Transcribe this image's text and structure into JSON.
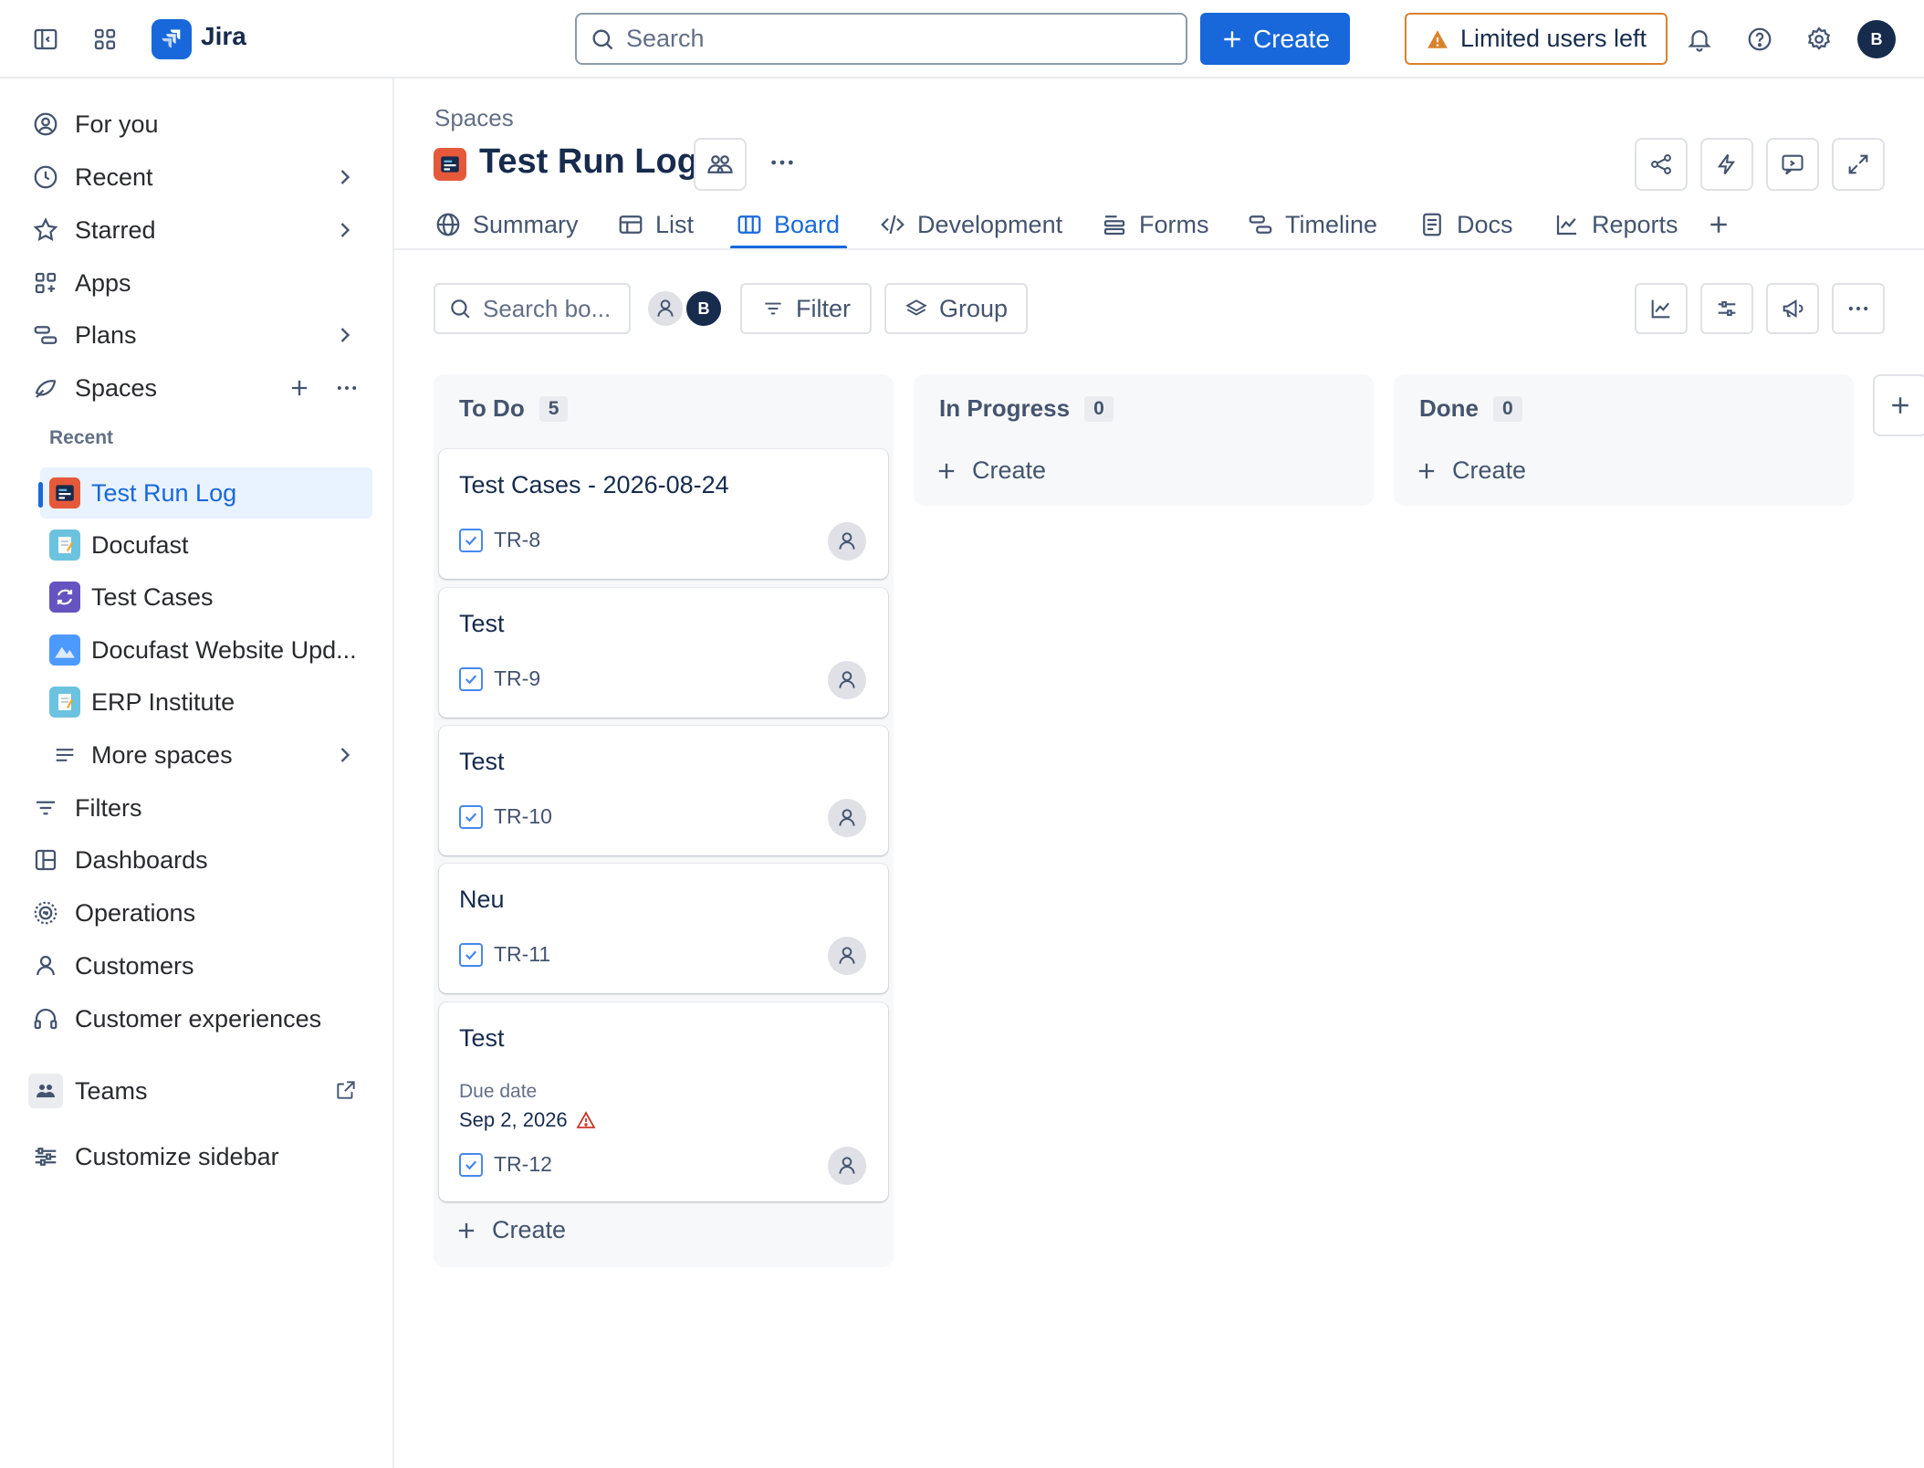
{
  "topbar": {
    "app_name": "Jira",
    "search_placeholder": "Search",
    "create_label": "Create",
    "limited_label": "Limited users left",
    "avatar_initial": "B"
  },
  "sidebar": {
    "items": [
      {
        "label": "For you"
      },
      {
        "label": "Recent"
      },
      {
        "label": "Starred"
      },
      {
        "label": "Apps"
      },
      {
        "label": "Plans"
      },
      {
        "label": "Spaces"
      }
    ],
    "recent_heading": "Recent",
    "spaces": [
      {
        "label": "Test Run Log",
        "icon_color": "#e5593a"
      },
      {
        "label": "Docufast",
        "icon_color": "#6cc3e0"
      },
      {
        "label": "Test Cases",
        "icon_color": "#6554c0"
      },
      {
        "label": "Docufast Website Upd...",
        "icon_color": "#4c9aff"
      },
      {
        "label": "ERP Institute",
        "icon_color": "#6cc3e0"
      }
    ],
    "more_spaces": "More spaces",
    "bottom_items": [
      {
        "label": "Filters"
      },
      {
        "label": "Dashboards"
      },
      {
        "label": "Operations"
      },
      {
        "label": "Customers"
      },
      {
        "label": "Customer experiences"
      }
    ],
    "teams": "Teams",
    "customize": "Customize sidebar"
  },
  "header": {
    "breadcrumb": "Spaces",
    "title": "Test Run Log"
  },
  "tabs": [
    {
      "label": "Summary"
    },
    {
      "label": "List"
    },
    {
      "label": "Board"
    },
    {
      "label": "Development"
    },
    {
      "label": "Forms"
    },
    {
      "label": "Timeline"
    },
    {
      "label": "Docs"
    },
    {
      "label": "Reports"
    }
  ],
  "toolbar": {
    "search_placeholder": "Search bo...",
    "filter_label": "Filter",
    "group_label": "Group",
    "avatar_initial": "B"
  },
  "columns": [
    {
      "name": "To Do",
      "count": "5",
      "cards": [
        {
          "title": "Test Cases - 2026-08-24",
          "key": "TR-8"
        },
        {
          "title": "Test",
          "key": "TR-9"
        },
        {
          "title": "Test",
          "key": "TR-10"
        },
        {
          "title": "Neu",
          "key": "TR-11"
        },
        {
          "title": "Test",
          "key": "TR-12",
          "due_label": "Due date",
          "due_value": "Sep 2, 2026"
        }
      ],
      "create_label": "Create"
    },
    {
      "name": "In Progress",
      "count": "0",
      "create_label": "Create"
    },
    {
      "name": "Done",
      "count": "0",
      "create_label": "Create"
    }
  ],
  "colors": {
    "accent": "#1868db",
    "warning": "#d9822b",
    "danger": "#c9372c"
  }
}
